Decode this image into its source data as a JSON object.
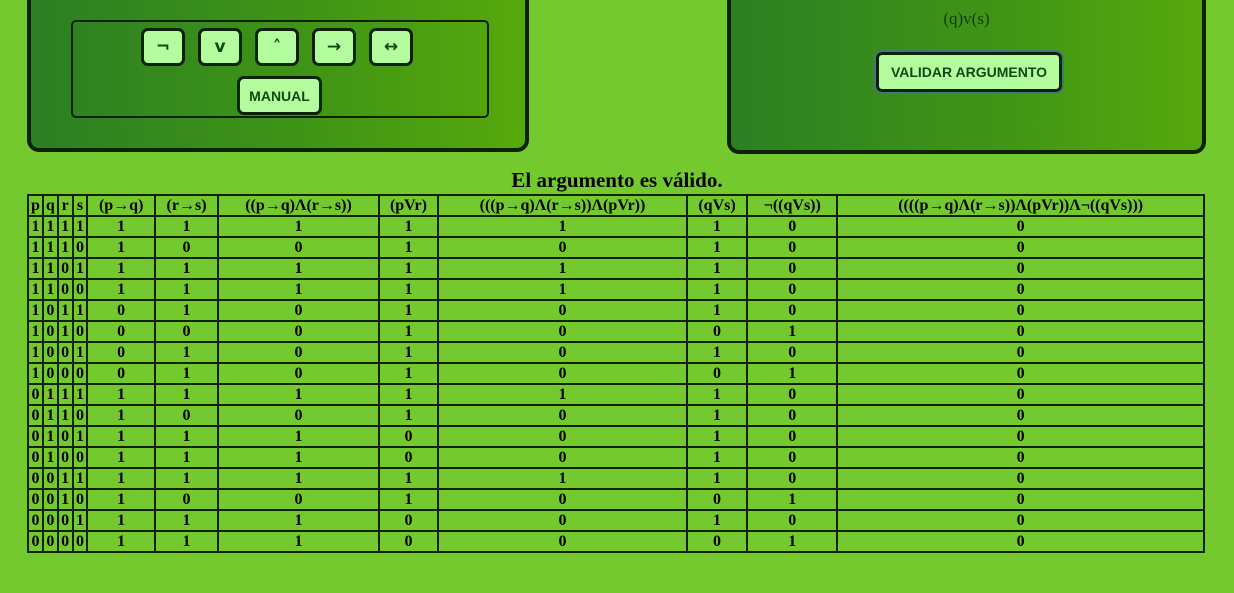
{
  "operators": [
    {
      "name": "not",
      "symbol": "¬"
    },
    {
      "name": "or",
      "symbol": "v"
    },
    {
      "name": "and",
      "symbol": "˄"
    },
    {
      "name": "implies",
      "symbol": "→"
    },
    {
      "name": "iff",
      "symbol": "↔"
    }
  ],
  "manual_label": "MANUAL",
  "conclusion": "(q)v(s)",
  "validate_label": "VALIDAR ARGUMENTO",
  "result_title": "El argumento es válido.",
  "table": {
    "headers": [
      "p",
      "q",
      "r",
      "s",
      "(p→q)",
      "(r→s)",
      "((p→q)Λ(r→s))",
      "(pVr)",
      "(((p→q)Λ(r→s))Λ(pVr))",
      "(qVs)",
      "¬((qVs))",
      "((((p→q)Λ(r→s))Λ(pVr))Λ¬((qVs)))"
    ],
    "rows": [
      [
        "1",
        "1",
        "1",
        "1",
        "1",
        "1",
        "1",
        "1",
        "1",
        "1",
        "0",
        "0"
      ],
      [
        "1",
        "1",
        "1",
        "0",
        "1",
        "0",
        "0",
        "1",
        "0",
        "1",
        "0",
        "0"
      ],
      [
        "1",
        "1",
        "0",
        "1",
        "1",
        "1",
        "1",
        "1",
        "1",
        "1",
        "0",
        "0"
      ],
      [
        "1",
        "1",
        "0",
        "0",
        "1",
        "1",
        "1",
        "1",
        "1",
        "1",
        "0",
        "0"
      ],
      [
        "1",
        "0",
        "1",
        "1",
        "0",
        "1",
        "0",
        "1",
        "0",
        "1",
        "0",
        "0"
      ],
      [
        "1",
        "0",
        "1",
        "0",
        "0",
        "0",
        "0",
        "1",
        "0",
        "0",
        "1",
        "0"
      ],
      [
        "1",
        "0",
        "0",
        "1",
        "0",
        "1",
        "0",
        "1",
        "0",
        "1",
        "0",
        "0"
      ],
      [
        "1",
        "0",
        "0",
        "0",
        "0",
        "1",
        "0",
        "1",
        "0",
        "0",
        "1",
        "0"
      ],
      [
        "0",
        "1",
        "1",
        "1",
        "1",
        "1",
        "1",
        "1",
        "1",
        "1",
        "0",
        "0"
      ],
      [
        "0",
        "1",
        "1",
        "0",
        "1",
        "0",
        "0",
        "1",
        "0",
        "1",
        "0",
        "0"
      ],
      [
        "0",
        "1",
        "0",
        "1",
        "1",
        "1",
        "1",
        "0",
        "0",
        "1",
        "0",
        "0"
      ],
      [
        "0",
        "1",
        "0",
        "0",
        "1",
        "1",
        "1",
        "0",
        "0",
        "1",
        "0",
        "0"
      ],
      [
        "0",
        "0",
        "1",
        "1",
        "1",
        "1",
        "1",
        "1",
        "1",
        "1",
        "0",
        "0"
      ],
      [
        "0",
        "0",
        "1",
        "0",
        "1",
        "0",
        "0",
        "1",
        "0",
        "0",
        "1",
        "0"
      ],
      [
        "0",
        "0",
        "0",
        "1",
        "1",
        "1",
        "1",
        "0",
        "0",
        "1",
        "0",
        "0"
      ],
      [
        "0",
        "0",
        "0",
        "0",
        "1",
        "1",
        "1",
        "0",
        "0",
        "0",
        "1",
        "0"
      ]
    ]
  },
  "colors": {
    "background": "#74c92f",
    "panel_dark": "#2d7f23",
    "panel_light": "#57a90c",
    "button_fill": "#b4fd9e",
    "border": "#0e2208"
  }
}
